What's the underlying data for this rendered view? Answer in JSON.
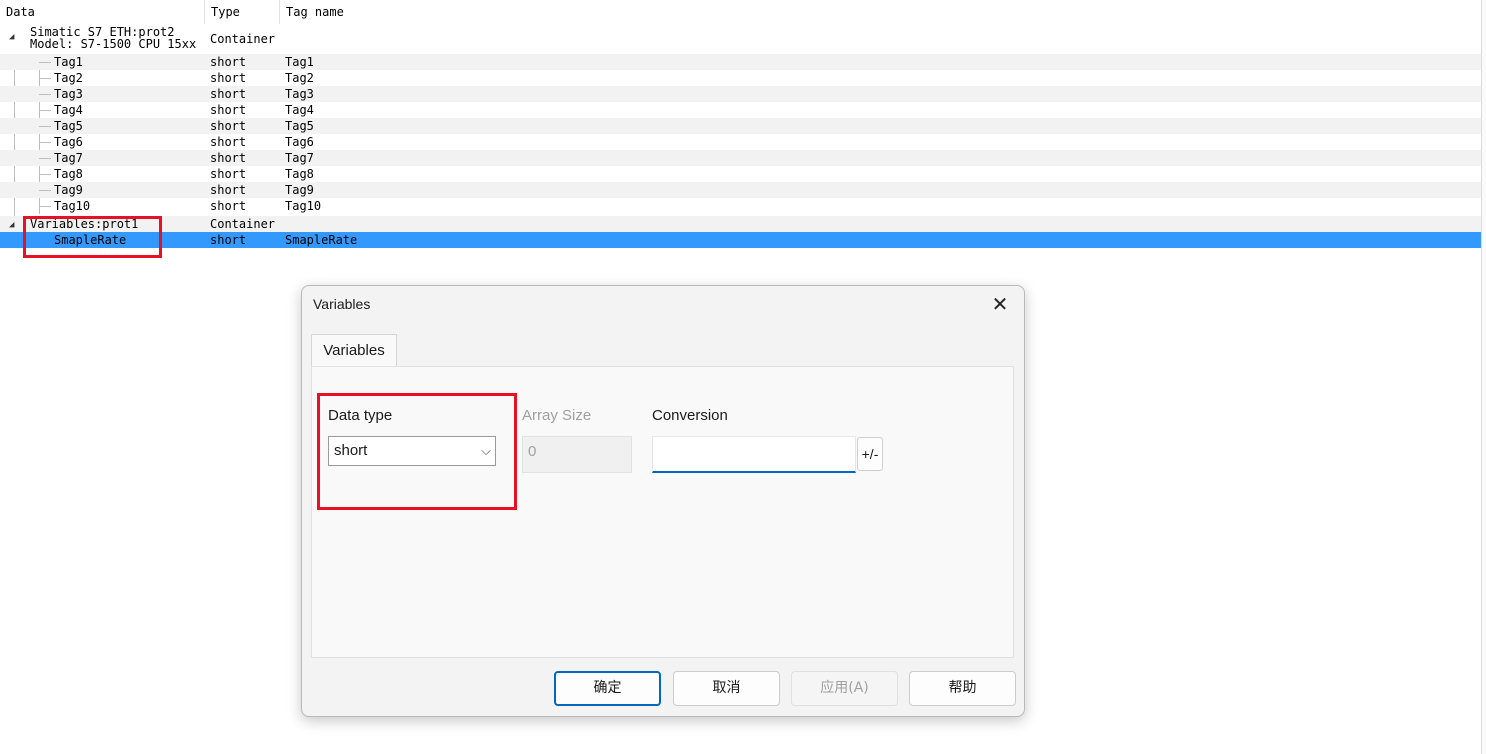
{
  "tree": {
    "columns": {
      "data": "Data",
      "type": "Type",
      "tag": "Tag name"
    },
    "root1": {
      "line1": "Simatic S7 ETH:prot2",
      "line2": "Model: S7-1500 CPU 15xx",
      "type": "Container"
    },
    "tags": [
      {
        "name": "Tag1",
        "type": "short",
        "tag": "Tag1"
      },
      {
        "name": "Tag2",
        "type": "short",
        "tag": "Tag2"
      },
      {
        "name": "Tag3",
        "type": "short",
        "tag": "Tag3"
      },
      {
        "name": "Tag4",
        "type": "short",
        "tag": "Tag4"
      },
      {
        "name": "Tag5",
        "type": "short",
        "tag": "Tag5"
      },
      {
        "name": "Tag6",
        "type": "short",
        "tag": "Tag6"
      },
      {
        "name": "Tag7",
        "type": "short",
        "tag": "Tag7"
      },
      {
        "name": "Tag8",
        "type": "short",
        "tag": "Tag8"
      },
      {
        "name": "Tag9",
        "type": "short",
        "tag": "Tag9"
      },
      {
        "name": "Tag10",
        "type": "short",
        "tag": "Tag10"
      }
    ],
    "root2": {
      "name": "Variables:prot1",
      "type": "Container"
    },
    "selected": {
      "name": "SmapleRate",
      "type": "short",
      "tag": "SmapleRate"
    }
  },
  "dialog": {
    "title": "Variables",
    "tab": "Variables",
    "data_type_label": "Data type",
    "data_type_value": "short",
    "array_size_label": "Array Size",
    "array_size_value": "0",
    "conversion_label": "Conversion",
    "conversion_value": "",
    "sign_button": "+/-",
    "buttons": {
      "ok": "确定",
      "cancel": "取消",
      "apply": "应用(A)",
      "help": "帮助"
    }
  },
  "colors": {
    "selection": "#3399ff",
    "highlight_box": "#e81123",
    "accent": "#0067c0"
  }
}
